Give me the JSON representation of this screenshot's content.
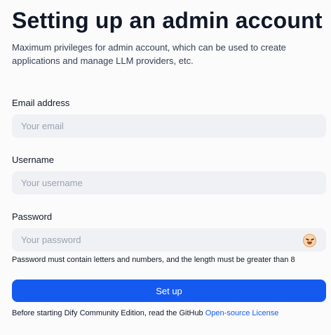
{
  "page": {
    "title": "Setting up an admin account",
    "subtitle": "Maximum privileges for admin account, which can be used to create applications and manage LLM providers, etc."
  },
  "form": {
    "email": {
      "label": "Email address",
      "placeholder": "Your email",
      "value": ""
    },
    "username": {
      "label": "Username",
      "placeholder": "Your username",
      "value": ""
    },
    "password": {
      "label": "Password",
      "placeholder": "Your password",
      "value": "",
      "toggle_icon": "emoji-face-icon",
      "hint": "Password must contain letters and numbers, and the length must be greater than 8"
    },
    "submit_label": "Set up"
  },
  "footer": {
    "text": "Before starting Dify Community Edition, read the GitHub",
    "link_label": "Open-source License"
  },
  "colors": {
    "accent": "#155aef",
    "input_bg": "#f0f1f4",
    "background": "#fbfbfc"
  }
}
